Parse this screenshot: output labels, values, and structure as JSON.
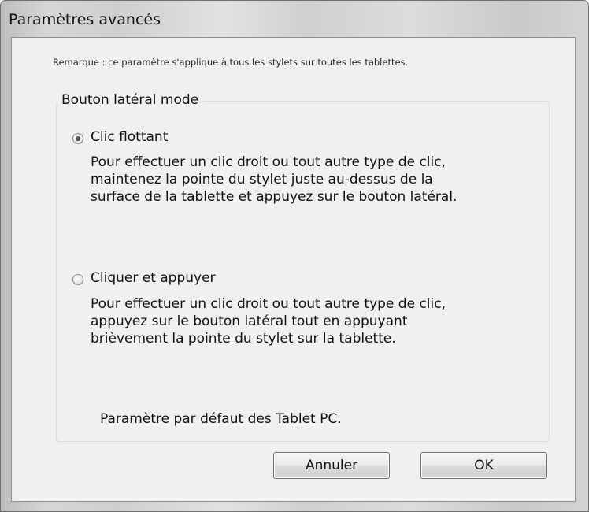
{
  "window": {
    "title": "Paramètres avancés"
  },
  "dialog": {
    "note": "Remarque : ce paramètre s'applique à tous les stylets sur toutes les tablettes.",
    "group_title": "Bouton latéral mode",
    "options": [
      {
        "label": "Clic flottant",
        "checked": true,
        "description": [
          "Pour effectuer un clic droit ou tout autre type de clic,",
          "maintenez la pointe du stylet juste au-dessus de la",
          "surface de la tablette et appuyez sur le bouton latéral."
        ]
      },
      {
        "label": "Cliquer et appuyer",
        "checked": false,
        "description": [
          "Pour effectuer un clic droit ou tout autre type de clic,",
          "appuyez sur le bouton latéral tout en appuyant",
          "brièvement la pointe du stylet sur la tablette."
        ]
      }
    ],
    "default_note": "Paramètre par défaut des Tablet PC."
  },
  "buttons": {
    "cancel": "Annuler",
    "ok": "OK"
  }
}
